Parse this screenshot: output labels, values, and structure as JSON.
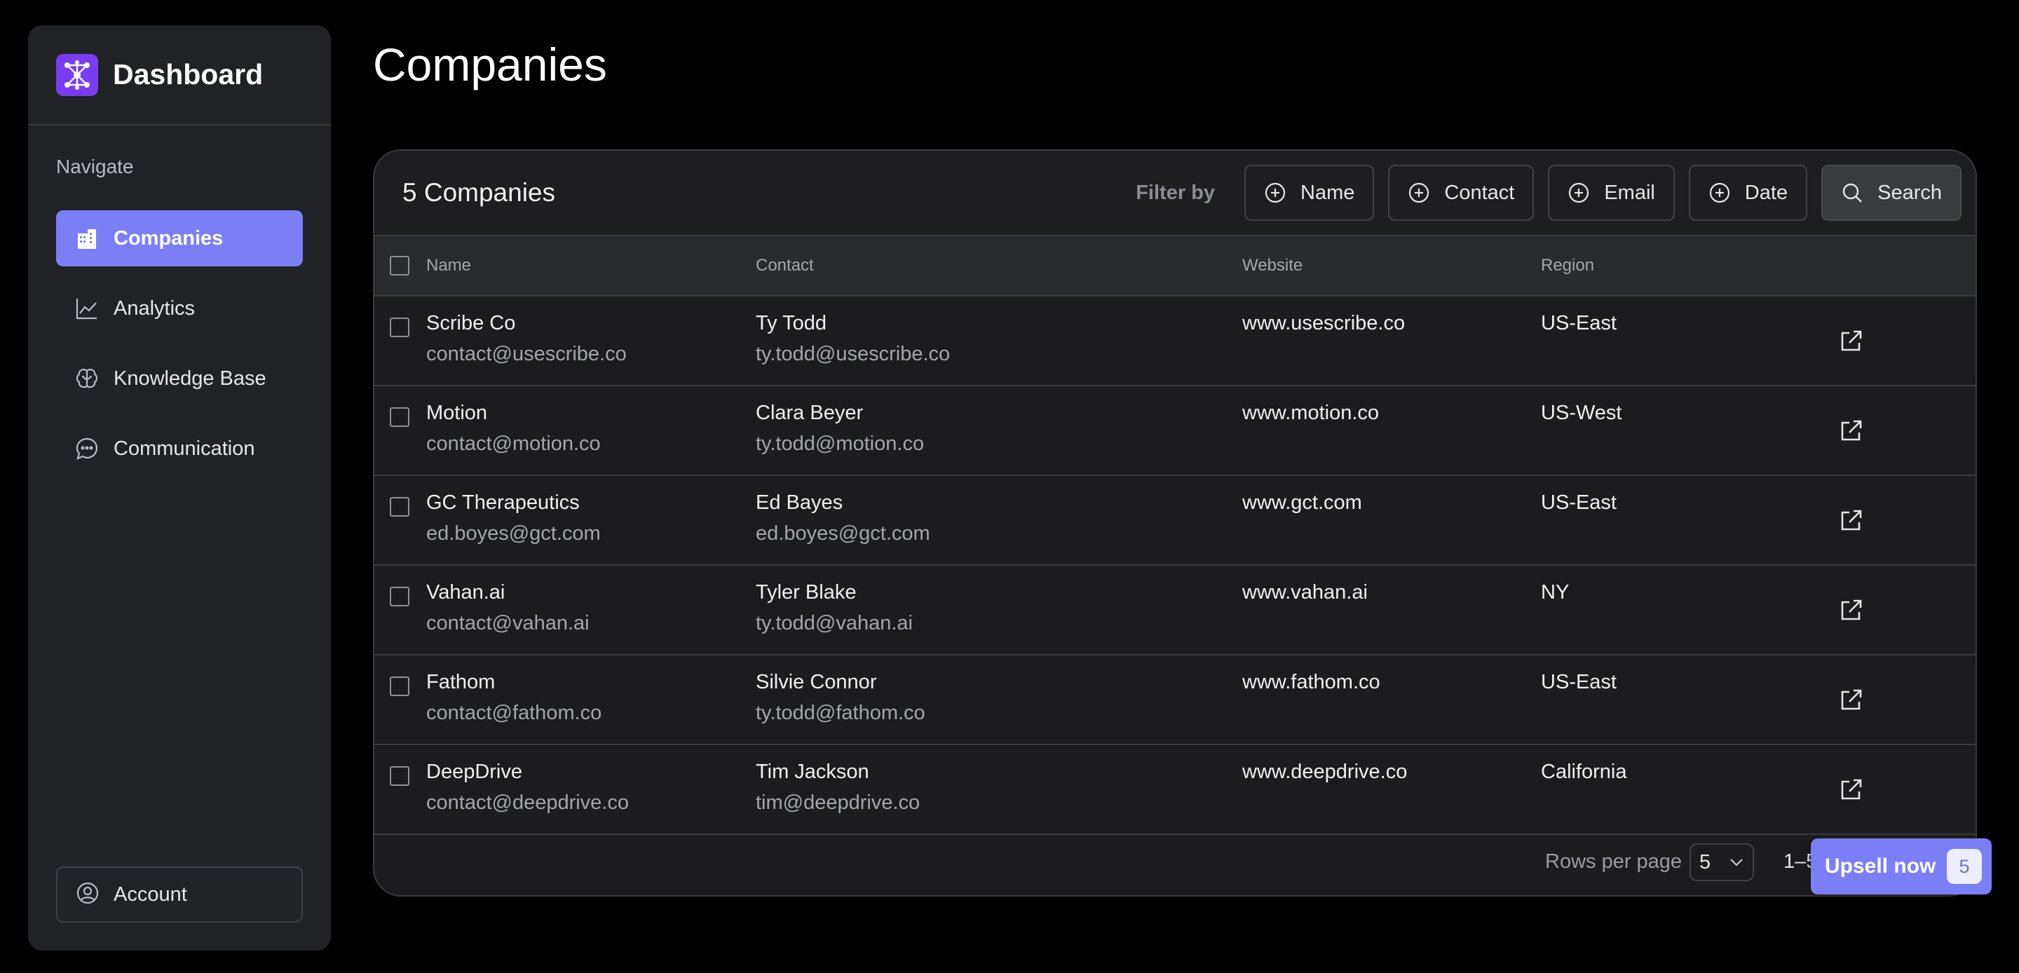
{
  "sidebar": {
    "brand": "Dashboard",
    "nav_heading": "Navigate",
    "items": [
      {
        "label": "Companies",
        "icon": "building-icon",
        "active": true
      },
      {
        "label": "Analytics",
        "icon": "line-chart-icon",
        "active": false
      },
      {
        "label": "Knowledge Base",
        "icon": "brain-icon",
        "active": false
      },
      {
        "label": "Communication",
        "icon": "chat-bubble-icon",
        "active": false
      }
    ],
    "account_label": "Account"
  },
  "main": {
    "title": "Companies",
    "count_label": "5 Companies",
    "filter_by": "Filter by",
    "filters": [
      "Name",
      "Contact",
      "Email",
      "Date"
    ],
    "search_label": "Search",
    "columns": [
      "Name",
      "Contact",
      "Website",
      "Region"
    ],
    "rows": [
      {
        "name": "Scribe Co",
        "name_email": "contact@usescribe.co",
        "contact": "Ty Todd",
        "contact_email": "ty.todd@usescribe.co",
        "website": "www.usescribe.co",
        "region": "US-East"
      },
      {
        "name": "Motion",
        "name_email": "contact@motion.co",
        "contact": "Clara Beyer",
        "contact_email": "ty.todd@motion.co",
        "website": "www.motion.co",
        "region": "US-West"
      },
      {
        "name": "GC Therapeutics",
        "name_email": "ed.boyes@gct.com",
        "contact": "Ed Bayes",
        "contact_email": "ed.boyes@gct.com",
        "website": "www.gct.com",
        "region": "US-East"
      },
      {
        "name": "Vahan.ai",
        "name_email": "contact@vahan.ai",
        "contact": "Tyler Blake",
        "contact_email": "ty.todd@vahan.ai",
        "website": "www.vahan.ai",
        "region": "NY"
      },
      {
        "name": "Fathom",
        "name_email": "contact@fathom.co",
        "contact": "Silvie Connor",
        "contact_email": "ty.todd@fathom.co",
        "website": "www.fathom.co",
        "region": "US-East"
      },
      {
        "name": "DeepDrive",
        "name_email": "contact@deepdrive.co",
        "contact": "Tim Jackson",
        "contact_email": "tim@deepdrive.co",
        "website": "www.deepdrive.co",
        "region": "California"
      }
    ],
    "footer": {
      "rows_per_page_label": "Rows per page",
      "rows_per_page_value": "5",
      "range_label": "1–5"
    }
  },
  "upsell": {
    "label": "Upsell now",
    "badge": "5"
  },
  "colors": {
    "accent": "#7b7ff6",
    "brand_logo": "#7a3cf0",
    "background": "#000000",
    "panel": "#1c1c1e"
  }
}
